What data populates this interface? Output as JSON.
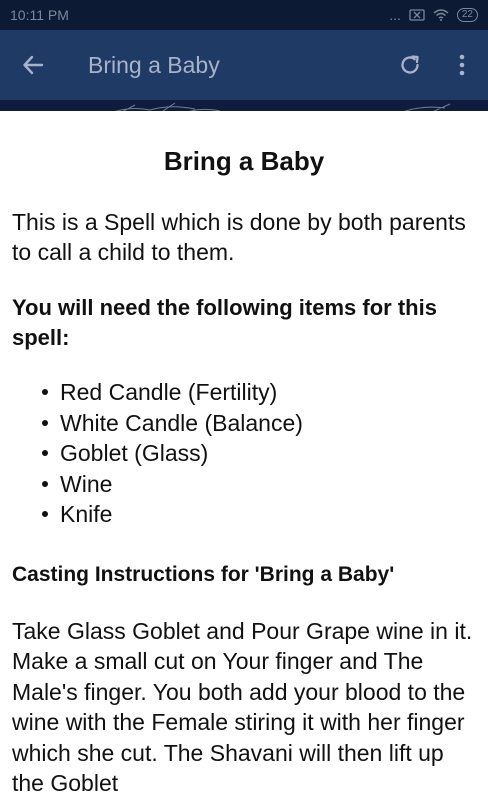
{
  "status_bar": {
    "time": "10:11 PM",
    "dots": "...",
    "battery": "22"
  },
  "toolbar": {
    "title": "Bring a Baby"
  },
  "article": {
    "title": "Bring a Baby",
    "intro": "This is a Spell which is done by both parents to call a child to them.",
    "need_heading": "You will need the following items for this spell:",
    "items": [
      "Red Candle (Fertility)",
      "White Candle (Balance)",
      "Goblet (Glass)",
      "Wine",
      "Knife"
    ],
    "casting_heading": "Casting Instructions for 'Bring a Baby'",
    "instructions": "Take Glass Goblet and Pour Grape wine in it.  Make a small cut on Your finger and The Male's finger. You both add your blood to the wine with the Female stiring it with her finger which she cut. The Shavani will then lift up the Goblet"
  },
  "colors": {
    "status_bar_bg": "#0d1a33",
    "toolbar_bg": "#203a66",
    "toolbar_text": "#a6b3c8"
  }
}
